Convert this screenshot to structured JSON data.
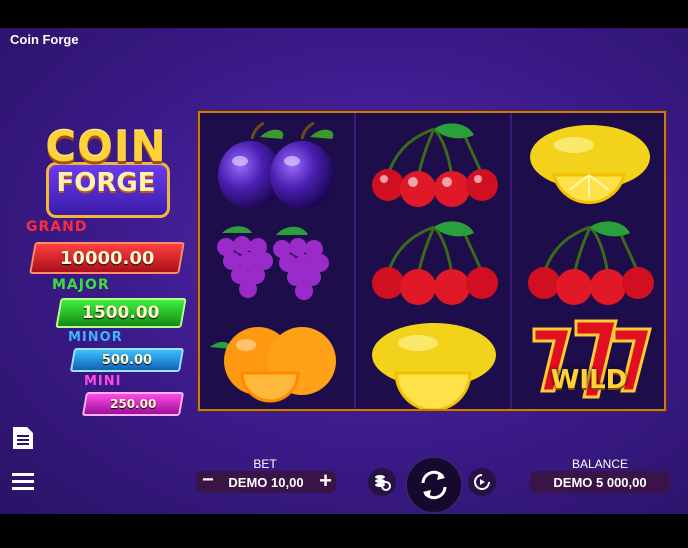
{
  "app": {
    "title": "Coin Forge"
  },
  "logo": {
    "line1": "COIN",
    "line2": "FORGE"
  },
  "jackpots": [
    {
      "name": "GRAND",
      "value": "10000.00",
      "color": "#e0232e"
    },
    {
      "name": "MAJOR",
      "value": "1500.00",
      "color": "#2fd02f"
    },
    {
      "name": "MINOR",
      "value": "500.00",
      "color": "#2aa7f0"
    },
    {
      "name": "MINI",
      "value": "250.00",
      "color": "#e335d2"
    }
  ],
  "reels": {
    "grid": [
      [
        "plum",
        "cherry",
        "lemon"
      ],
      [
        "grapes",
        "cherry",
        "cherry"
      ],
      [
        "orange",
        "lemon",
        "wild"
      ]
    ],
    "wild_label": "WILD"
  },
  "controls": {
    "bet_label": "BET",
    "bet_value": "DEMO 10,00",
    "balance_label": "BALANCE",
    "balance_value": "DEMO 5 000,00",
    "minus": "−",
    "plus": "+"
  },
  "icons": {
    "paytable": "document-icon",
    "menu": "hamburger-menu-icon",
    "coins_settings": "coins-settings-icon",
    "spin": "spin-arrows-icon",
    "autoplay": "autoplay-icon"
  }
}
